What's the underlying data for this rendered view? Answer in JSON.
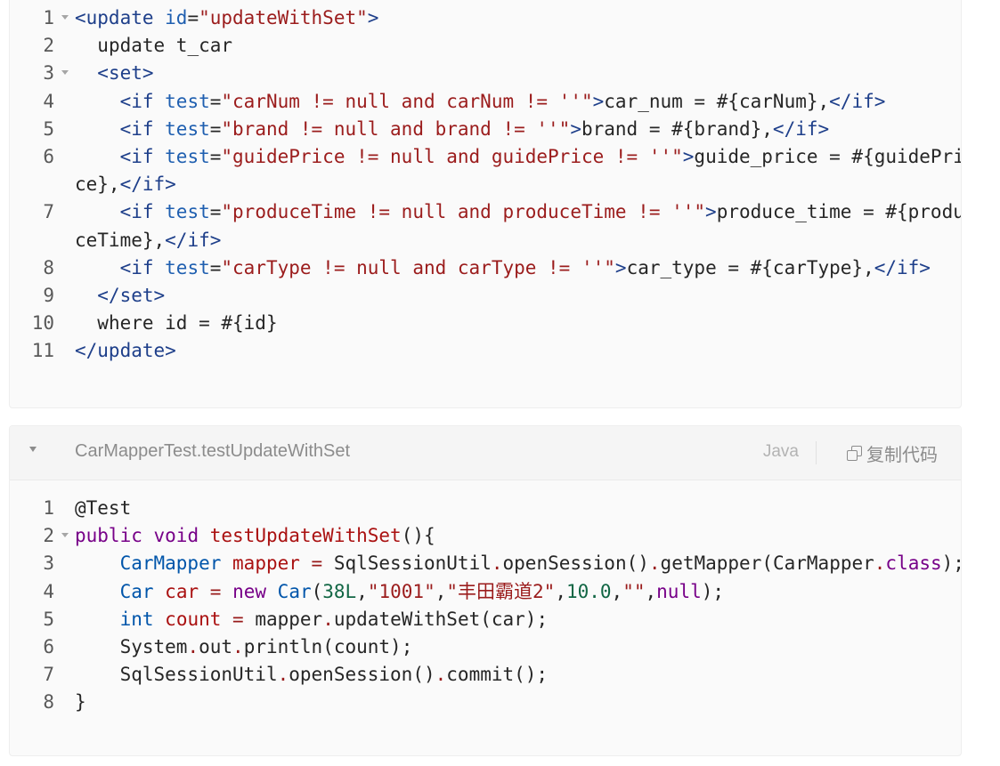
{
  "blocks": [
    {
      "id": "xml",
      "title": "",
      "lines": [
        {
          "n": "1",
          "fold": true,
          "tokens": [
            [
              "tag",
              "<update "
            ],
            [
              "attr",
              "id"
            ],
            [
              "",
              "="
            ],
            [
              "str",
              "\"updateWithSet\""
            ],
            [
              "tag",
              ">"
            ]
          ]
        },
        {
          "n": "2",
          "fold": false,
          "tokens": [
            [
              "",
              "  update t_car"
            ]
          ]
        },
        {
          "n": "3",
          "fold": true,
          "tokens": [
            [
              "",
              "  "
            ],
            [
              "tag",
              "<set>"
            ]
          ]
        },
        {
          "n": "4",
          "fold": false,
          "tokens": [
            [
              "",
              "    "
            ],
            [
              "tag",
              "<if "
            ],
            [
              "attr",
              "test"
            ],
            [
              "",
              "="
            ],
            [
              "str",
              "\"carNum != null and carNum != ''\""
            ],
            [
              "tag",
              ">"
            ],
            [
              "",
              "car_num = #{carNum},"
            ],
            [
              "tag",
              "</if>"
            ]
          ]
        },
        {
          "n": "5",
          "fold": false,
          "tokens": [
            [
              "",
              "    "
            ],
            [
              "tag",
              "<if "
            ],
            [
              "attr",
              "test"
            ],
            [
              "",
              "="
            ],
            [
              "str",
              "\"brand != null and brand != ''\""
            ],
            [
              "tag",
              ">"
            ],
            [
              "",
              "brand = #{brand},"
            ],
            [
              "tag",
              "</if>"
            ]
          ]
        },
        {
          "n": "6",
          "fold": false,
          "tokens": [
            [
              "",
              "    "
            ],
            [
              "tag",
              "<if "
            ],
            [
              "attr",
              "test"
            ],
            [
              "",
              "="
            ],
            [
              "str",
              "\"guidePrice != null and guidePrice != ''\""
            ],
            [
              "tag",
              ">"
            ],
            [
              "",
              "guide_price = #{guidePrice},"
            ],
            [
              "tag",
              "</if>"
            ]
          ]
        },
        {
          "n": "7",
          "fold": false,
          "tokens": [
            [
              "",
              "    "
            ],
            [
              "tag",
              "<if "
            ],
            [
              "attr",
              "test"
            ],
            [
              "",
              "="
            ],
            [
              "str",
              "\"produceTime != null and produceTime != ''\""
            ],
            [
              "tag",
              ">"
            ],
            [
              "",
              "produce_time = #{produceTime},"
            ],
            [
              "tag",
              "</if>"
            ]
          ]
        },
        {
          "n": "8",
          "fold": false,
          "tokens": [
            [
              "",
              "    "
            ],
            [
              "tag",
              "<if "
            ],
            [
              "attr",
              "test"
            ],
            [
              "",
              "="
            ],
            [
              "str",
              "\"carType != null and carType != ''\""
            ],
            [
              "tag",
              ">"
            ],
            [
              "",
              "car_type = #{carType},"
            ],
            [
              "tag",
              "</if>"
            ]
          ]
        },
        {
          "n": "9",
          "fold": false,
          "tokens": [
            [
              "",
              "  "
            ],
            [
              "tag",
              "</set>"
            ]
          ]
        },
        {
          "n": "10",
          "fold": false,
          "tokens": [
            [
              "",
              "  where id = #{id}"
            ]
          ]
        },
        {
          "n": "11",
          "fold": false,
          "tokens": [
            [
              "tag",
              "</update>"
            ]
          ]
        }
      ]
    },
    {
      "id": "java",
      "title": "CarMapperTest.testUpdateWithSet",
      "language": "Java",
      "copy_label": "复制代码",
      "lines": [
        {
          "n": "1",
          "fold": false,
          "tokens": [
            [
              "",
              "@Test"
            ]
          ]
        },
        {
          "n": "2",
          "fold": true,
          "tokens": [
            [
              "kw",
              "public"
            ],
            [
              "",
              " "
            ],
            [
              "kw",
              "void"
            ],
            [
              "",
              " "
            ],
            [
              "fn",
              "testUpdateWithSet"
            ],
            [
              "",
              "(){"
            ]
          ]
        },
        {
          "n": "3",
          "fold": false,
          "tokens": [
            [
              "",
              "    "
            ],
            [
              "ty",
              "CarMapper"
            ],
            [
              "",
              " "
            ],
            [
              "fn",
              "mapper"
            ],
            [
              "",
              " "
            ],
            [
              "op",
              "="
            ],
            [
              "",
              " SqlSessionUtil"
            ],
            [
              "op",
              "."
            ],
            [
              "",
              "openSession()"
            ],
            [
              "op",
              "."
            ],
            [
              "",
              "getMapper(CarMapper"
            ],
            [
              "op",
              "."
            ],
            [
              "kw",
              "class"
            ],
            [
              "",
              ");"
            ]
          ]
        },
        {
          "n": "4",
          "fold": false,
          "tokens": [
            [
              "",
              "    "
            ],
            [
              "ty",
              "Car"
            ],
            [
              "",
              " "
            ],
            [
              "fn",
              "car"
            ],
            [
              "",
              " "
            ],
            [
              "op",
              "="
            ],
            [
              "",
              " "
            ],
            [
              "kw",
              "new"
            ],
            [
              "",
              " "
            ],
            [
              "ty",
              "Car"
            ],
            [
              "",
              "("
            ],
            [
              "num",
              "38L"
            ],
            [
              "",
              ","
            ],
            [
              "str",
              "\"1001\""
            ],
            [
              "",
              ","
            ],
            [
              "str",
              "\"丰田霸道2\""
            ],
            [
              "",
              ","
            ],
            [
              "num",
              "10.0"
            ],
            [
              "",
              ","
            ],
            [
              "str",
              "\"\""
            ],
            [
              "",
              ","
            ],
            [
              "kw",
              "null"
            ],
            [
              "",
              ");"
            ]
          ]
        },
        {
          "n": "5",
          "fold": false,
          "tokens": [
            [
              "",
              "    "
            ],
            [
              "ty",
              "int"
            ],
            [
              "",
              " "
            ],
            [
              "fn",
              "count"
            ],
            [
              "",
              " "
            ],
            [
              "op",
              "="
            ],
            [
              "",
              " mapper"
            ],
            [
              "op",
              "."
            ],
            [
              "",
              "updateWithSet(car);"
            ]
          ]
        },
        {
          "n": "6",
          "fold": false,
          "tokens": [
            [
              "",
              "    System"
            ],
            [
              "op",
              "."
            ],
            [
              "",
              "out"
            ],
            [
              "op",
              "."
            ],
            [
              "",
              "println(count);"
            ]
          ]
        },
        {
          "n": "7",
          "fold": false,
          "tokens": [
            [
              "",
              "    SqlSessionUtil"
            ],
            [
              "op",
              "."
            ],
            [
              "",
              "openSession()"
            ],
            [
              "op",
              "."
            ],
            [
              "",
              "commit();"
            ]
          ]
        },
        {
          "n": "8",
          "fold": false,
          "tokens": [
            [
              "",
              "}"
            ]
          ]
        }
      ]
    }
  ]
}
